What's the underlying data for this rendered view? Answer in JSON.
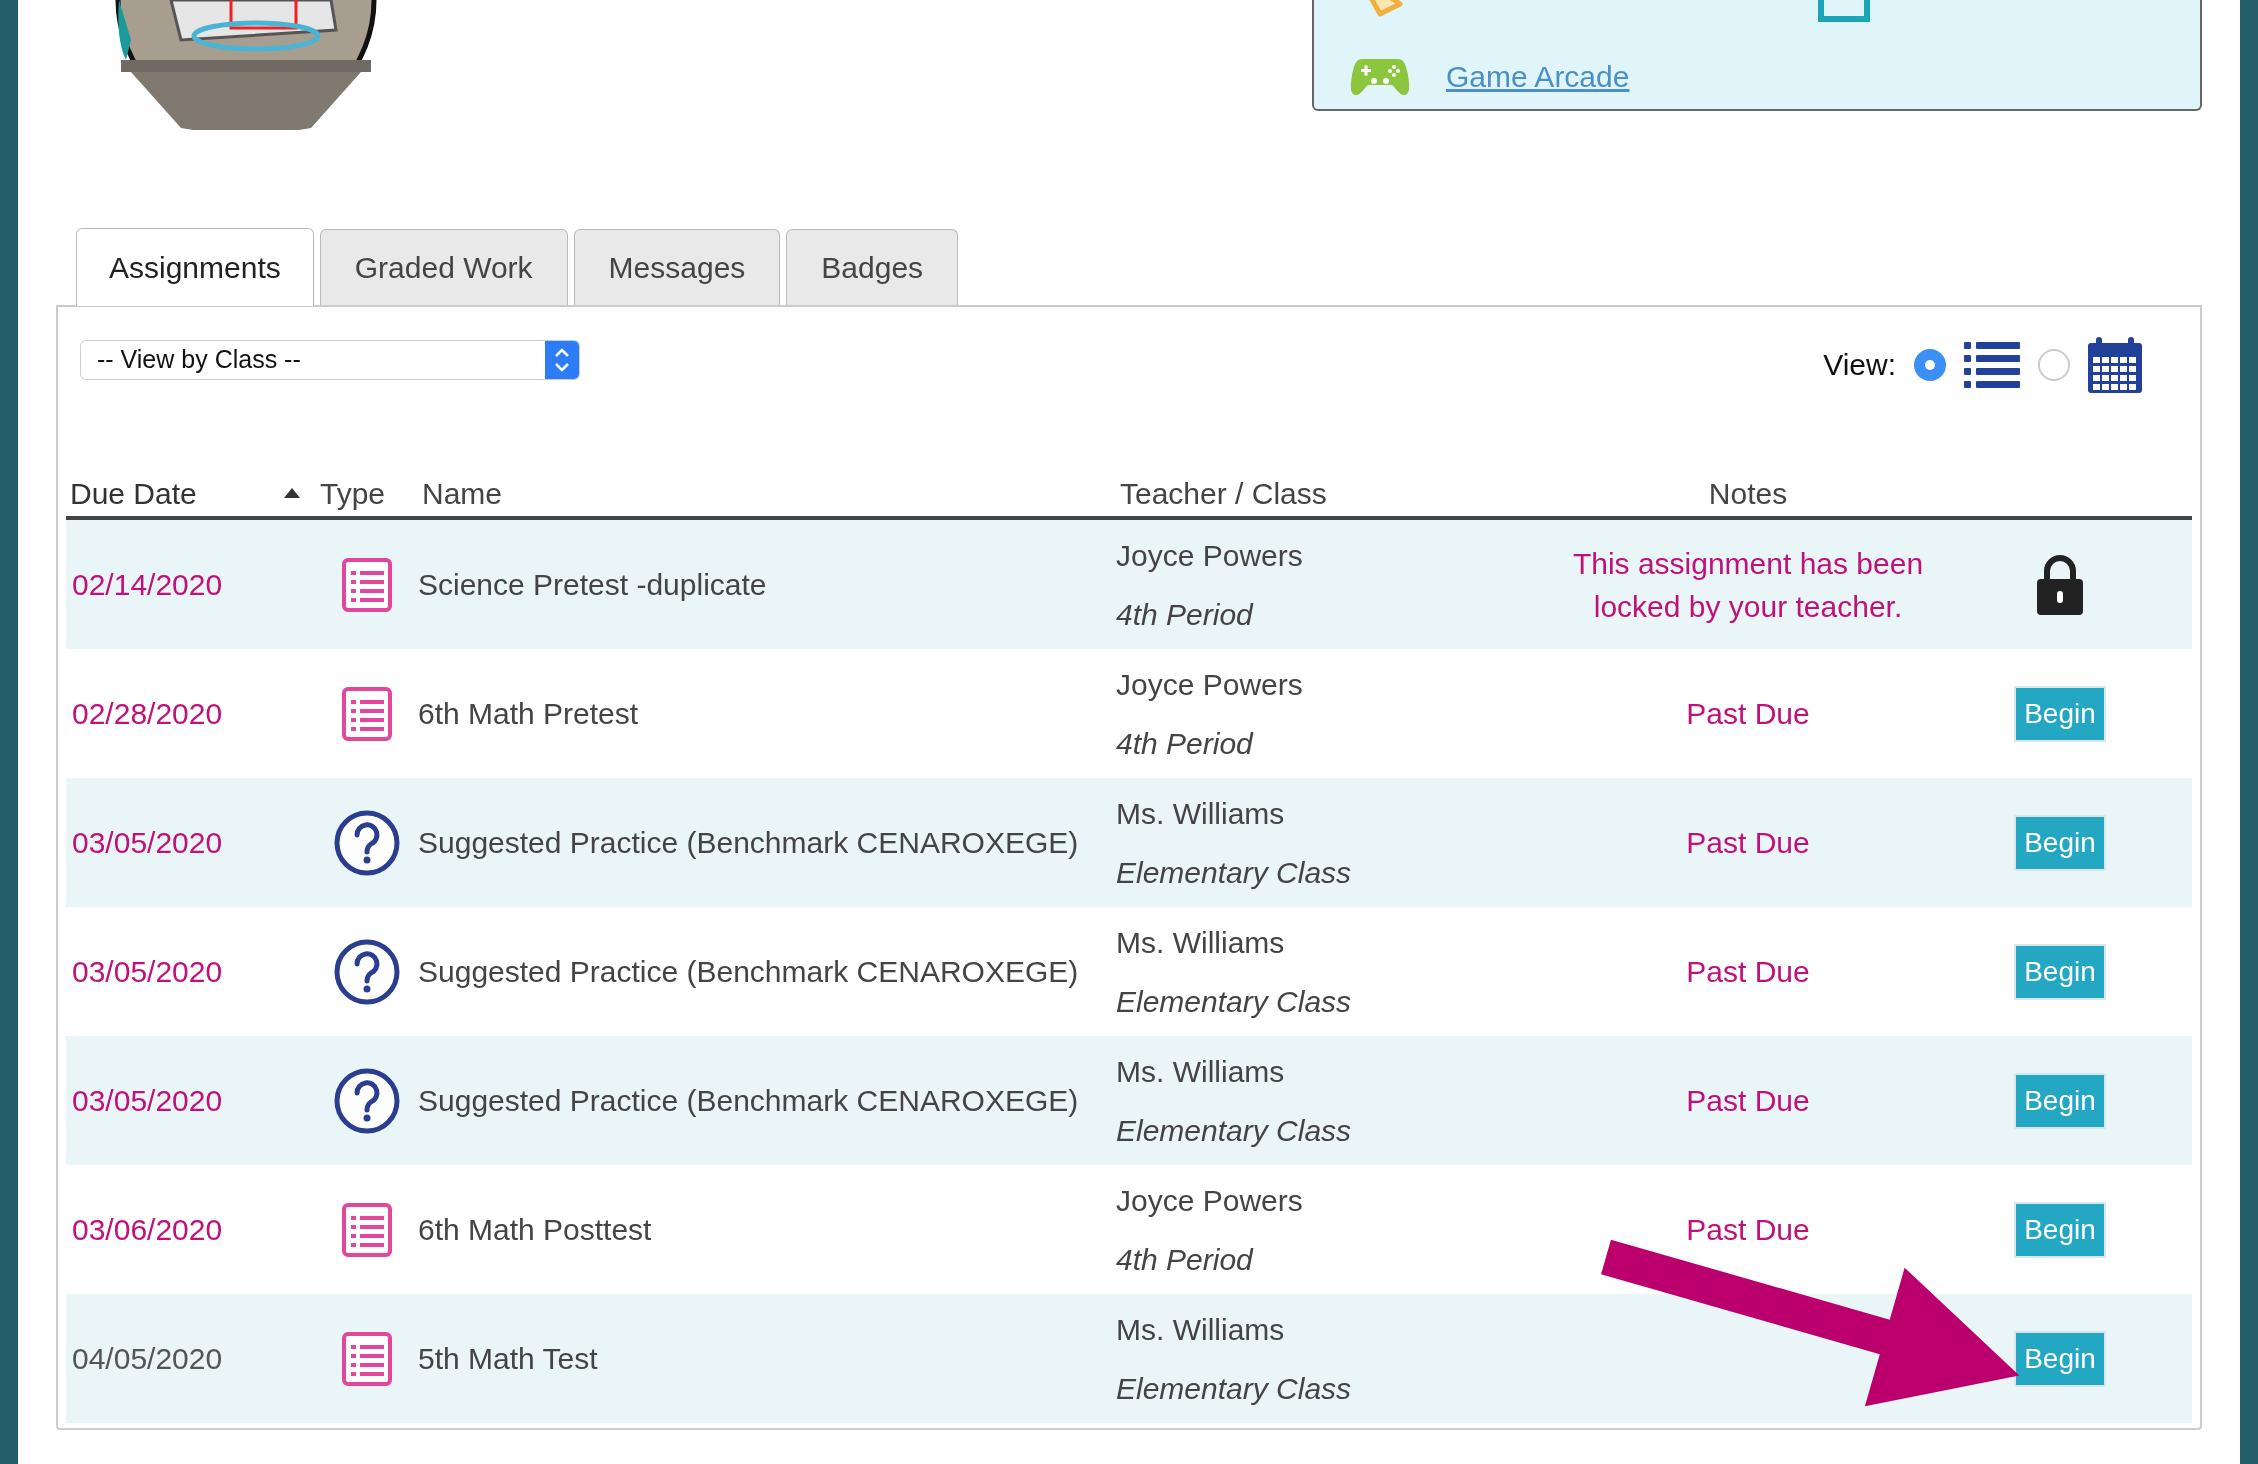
{
  "quick_links": [
    {
      "kind": "party"
    },
    {
      "kind": "test"
    },
    {
      "kind": "game",
      "label": "Game Arcade"
    }
  ],
  "tabs": [
    {
      "label": "Assignments",
      "selected": true
    },
    {
      "label": "Graded Work",
      "selected": false
    },
    {
      "label": "Messages",
      "selected": false
    },
    {
      "label": "Badges",
      "selected": false
    }
  ],
  "class_filter": {
    "value": "-- View by Class --"
  },
  "view": {
    "label": "View:",
    "options": [
      {
        "kind": "list",
        "selected": true
      },
      {
        "kind": "calendar",
        "selected": false
      }
    ]
  },
  "table": {
    "columns": [
      {
        "label": "Due Date",
        "sorted": true
      },
      {
        "label": "Type",
        "sorted": false
      },
      {
        "label": "Name",
        "sorted": false
      },
      {
        "label": "Teacher / Class",
        "sorted": false
      },
      {
        "label": "Notes",
        "sorted": false
      }
    ],
    "rows": [
      {
        "due_date": "02/14/2020",
        "overdue": true,
        "kind": "test",
        "name": "Science Pretest -duplicate",
        "teacher": "Joyce Powers",
        "class": "4th Period",
        "note": "This assignment has been locked by your teacher.",
        "action": {
          "kind": "lock"
        }
      },
      {
        "due_date": "02/28/2020",
        "overdue": true,
        "kind": "test",
        "name": "6th Math Pretest",
        "teacher": "Joyce Powers",
        "class": "4th Period",
        "note": "Past Due",
        "action": {
          "kind": "button",
          "label": "Begin"
        }
      },
      {
        "due_date": "03/05/2020",
        "overdue": true,
        "kind": "practice",
        "name": "Suggested Practice (Benchmark CENAROXEGE)",
        "teacher": "Ms. Williams",
        "class": "Elementary Class",
        "note": "Past Due",
        "action": {
          "kind": "button",
          "label": "Begin"
        }
      },
      {
        "due_date": "03/05/2020",
        "overdue": true,
        "kind": "practice",
        "name": "Suggested Practice (Benchmark CENAROXEGE)",
        "teacher": "Ms. Williams",
        "class": "Elementary Class",
        "note": "Past Due",
        "action": {
          "kind": "button",
          "label": "Begin"
        }
      },
      {
        "due_date": "03/05/2020",
        "overdue": true,
        "kind": "practice",
        "name": "Suggested Practice (Benchmark CENAROXEGE)",
        "teacher": "Ms. Williams",
        "class": "Elementary Class",
        "note": "Past Due",
        "action": {
          "kind": "button",
          "label": "Begin"
        }
      },
      {
        "due_date": "03/06/2020",
        "overdue": true,
        "kind": "test",
        "name": "6th Math Posttest",
        "teacher": "Joyce Powers",
        "class": "4th Period",
        "note": "Past Due",
        "action": {
          "kind": "button",
          "label": "Begin"
        }
      },
      {
        "due_date": "04/05/2020",
        "overdue": false,
        "kind": "test",
        "name": "5th Math Test",
        "teacher": "Ms. Williams",
        "class": "Elementary Class",
        "action": {
          "kind": "button",
          "label": "Begin"
        }
      }
    ]
  },
  "annotation": {
    "kind": "arrow"
  }
}
